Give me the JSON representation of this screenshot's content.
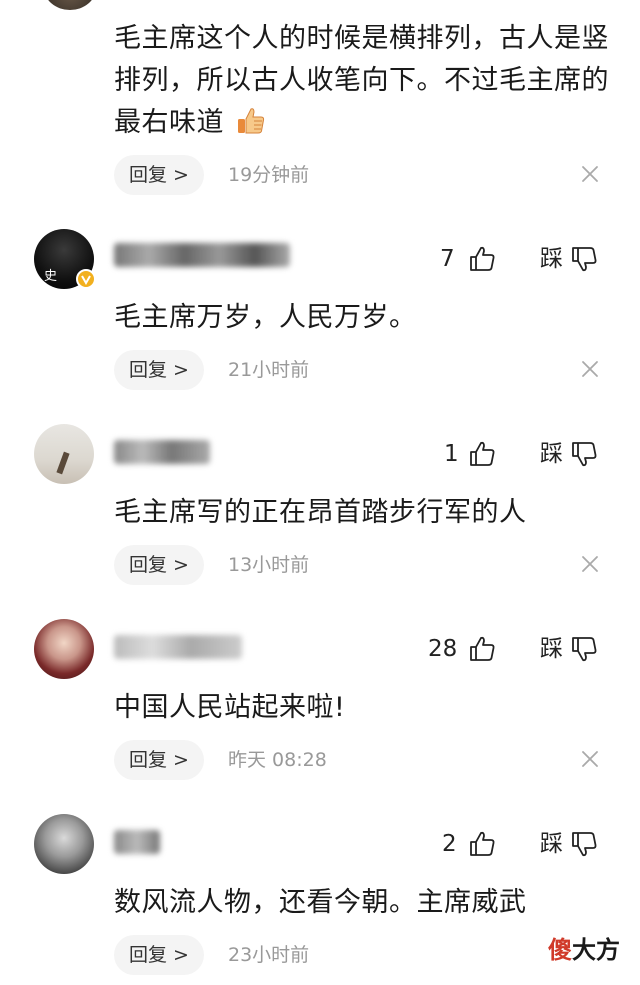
{
  "comments": [
    {
      "text": "毛主席这个人的时候是横排列，古人是竖排列，所以古人收笔向下。不过毛主席的最右味道",
      "reply_label": "回复 >",
      "time": "19分钟前",
      "likes": "",
      "dislike_label": ""
    },
    {
      "text": "毛主席万岁，人民万岁。",
      "reply_label": "回复 >",
      "time": "21小时前",
      "likes": "7",
      "dislike_label": "踩"
    },
    {
      "text": "毛主席写的正在昂首踏步行军的人",
      "reply_label": "回复 >",
      "time": "13小时前",
      "likes": "1",
      "dislike_label": "踩"
    },
    {
      "text": "中国人民站起来啦!",
      "reply_label": "回复 >",
      "time": "昨天  08:28",
      "likes": "28",
      "dislike_label": "踩"
    },
    {
      "text": "数风流人物，还看今朝。主席威武",
      "reply_label": "回复 >",
      "time": "23小时前",
      "likes": "2",
      "dislike_label": "踩"
    }
  ],
  "avatar_badge": "史",
  "watermark": {
    "part1": "傻",
    "part2": "大方"
  },
  "colors": {
    "reply_bg": "#f4f4f4",
    "time_gray": "#999999",
    "verified_badge": "#f2b01e",
    "watermark_red": "#d03a2a"
  },
  "icons": {
    "like": "thumbs-up-icon",
    "dislike": "thumbs-down-icon",
    "close": "close-icon",
    "emoji": "thumbs-up-emoji"
  }
}
